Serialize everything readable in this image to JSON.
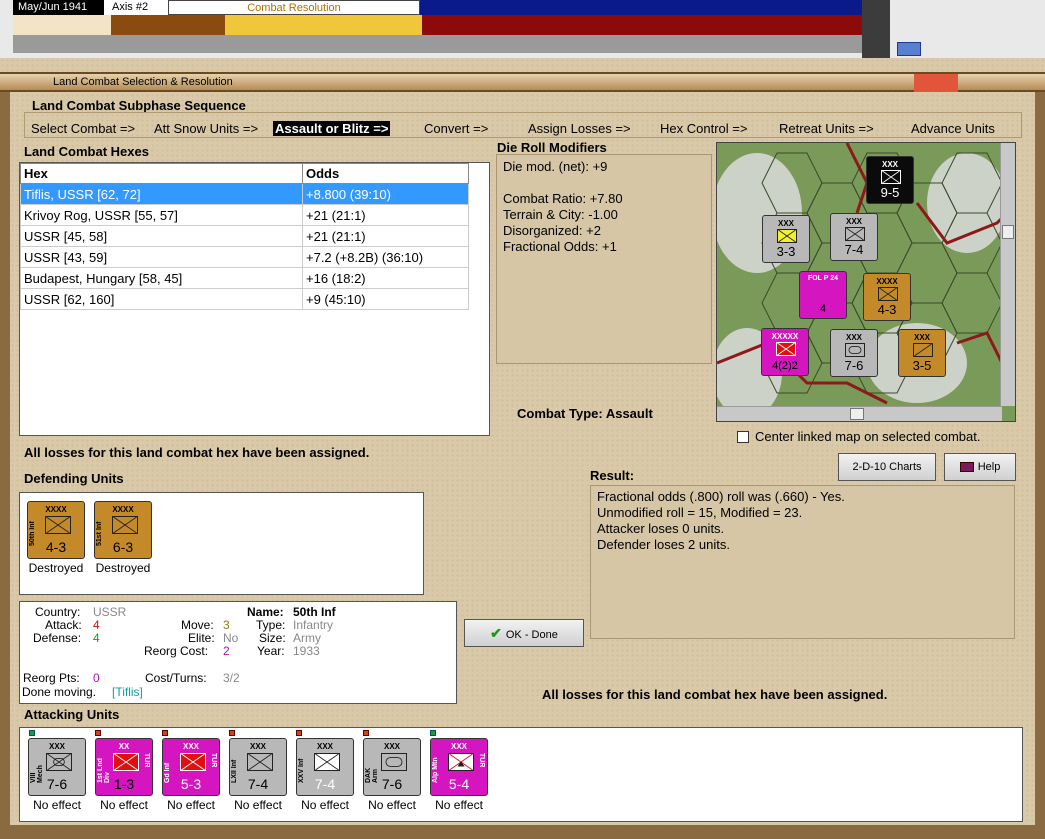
{
  "top": {
    "date": "May/Jun 1941",
    "axis": "Axis #2",
    "phase": "Combat Resolution"
  },
  "window": {
    "title": "Land Combat Selection & Resolution"
  },
  "sequence": {
    "header": "Land Combat Subphase Sequence",
    "steps": [
      "Select Combat =>",
      "Att Snow Units =>",
      "Assault or Blitz =>",
      "Convert =>",
      "Assign Losses =>",
      "Hex Control =>",
      "Retreat Units =>",
      "Advance Units"
    ],
    "active_index": 2
  },
  "hexes": {
    "header": "Land Combat Hexes",
    "columns": [
      "Hex",
      "Odds"
    ],
    "rows": [
      {
        "hex": "Tiflis, USSR [62, 72]",
        "odds": "+8.800 (39:10)"
      },
      {
        "hex": "Krivoy Rog, USSR [55, 57]",
        "odds": "+21 (21:1)"
      },
      {
        "hex": "USSR [45, 58]",
        "odds": "+21 (21:1)"
      },
      {
        "hex": "USSR [43, 59]",
        "odds": "+7.2 (+8.2B) (36:10)"
      },
      {
        "hex": "Budapest, Hungary [58, 45]",
        "odds": "+16 (18:2)"
      },
      {
        "hex": "USSR [62, 160]",
        "odds": "+9 (45:10)"
      }
    ]
  },
  "die_roll": {
    "header": "Die Roll Modifiers",
    "lines": [
      "Die mod. (net): +9",
      "",
      "Combat Ratio: +7.80",
      "Terrain & City: -1.00",
      "Disorganized: +2",
      "Fractional Odds: +1"
    ]
  },
  "combat_type": "Combat Type:  Assault",
  "center_map_label": "Center linked map on selected combat.",
  "losses_msg": "All losses for this land combat hex have been assigned.",
  "buttons": {
    "charts": "2-D-10 Charts",
    "help": "Help",
    "ok": "OK - Done"
  },
  "defending": {
    "header": "Defending Units",
    "units": [
      {
        "name": "50th Inf",
        "size": "XXXX",
        "str": "4-3",
        "status": "Destroyed"
      },
      {
        "name": "51st Inf",
        "size": "XXXX",
        "str": "6-3",
        "status": "Destroyed"
      }
    ]
  },
  "unit_info": {
    "country_label": "Country:",
    "country": "USSR",
    "attack_label": "Attack:",
    "attack": "4",
    "defense_label": "Defense:",
    "defense": "4",
    "move_label": "Move:",
    "move": "3",
    "elite_label": "Elite:",
    "elite": "No",
    "reorg_cost_label": "Reorg Cost:",
    "reorg_cost": "2",
    "name_label": "Name:",
    "name": "50th Inf",
    "type_label": "Type:",
    "type": "Infantry",
    "size_label": "Size:",
    "size": "Army",
    "year_label": "Year:",
    "year": "1933",
    "reorg_pts_label": "Reorg Pts:",
    "reorg_pts": "0",
    "cost_turns_label": "Cost/Turns:",
    "cost_turns": "3/2",
    "done_moving": "Done moving.",
    "done_moving_loc": "[Tiflis]"
  },
  "result": {
    "header": "Result:",
    "lines": [
      "Fractional odds (.800) roll was (.660)  - Yes.",
      "Unmodified roll = 15, Modified = 23.",
      "Attacker loses 0 units.",
      "Defender loses 2 units."
    ]
  },
  "attacking": {
    "header": "Attacking Units",
    "units": [
      {
        "name": "VIII Mech",
        "size": "XXX",
        "str": "7-6",
        "status": "No effect",
        "nation": ""
      },
      {
        "name": "1st Lnd Div",
        "size": "XX",
        "str": "1-3",
        "status": "No effect",
        "nation": "TUR"
      },
      {
        "name": "Gd Inf",
        "size": "XXX",
        "str": "5-3",
        "status": "No effect",
        "nation": "TUR"
      },
      {
        "name": "LXII Inf",
        "size": "XXX",
        "str": "7-4",
        "status": "No effect",
        "nation": ""
      },
      {
        "name": "XXV Inf",
        "size": "XXX",
        "str": "7-4",
        "status": "No effect",
        "nation": ""
      },
      {
        "name": "DAK Arm",
        "size": "XXX",
        "str": "7-6",
        "status": "No effect",
        "nation": ""
      },
      {
        "name": "Alp Mtn",
        "size": "XXX",
        "str": "5-4",
        "status": "No effect",
        "nation": "TUR"
      }
    ]
  },
  "map": {
    "counters": [
      {
        "name": "IX SS Mech",
        "str": "9-5",
        "size": "XXX"
      },
      {
        "name": "II Inf",
        "str": "3-3",
        "size": "XXX",
        "nation": "ROM"
      },
      {
        "name": "LXIII Inf",
        "str": "7-4",
        "size": "XXX"
      },
      {
        "name": "FOL P 24",
        "str": "4",
        "size": ""
      },
      {
        "name": "Tiflis Inf",
        "str": "4-3",
        "size": "XXXX"
      },
      {
        "name": "4(2)2",
        "str": "4(2)2",
        "size": "XXXXX",
        "nation": "TUR"
      },
      {
        "name": "DAK Arm",
        "str": "7-6",
        "size": "XXX"
      },
      {
        "name": "3rd Gd Cav",
        "str": "3-5",
        "size": "XXX"
      }
    ]
  },
  "colors": {
    "tan": "#d9c9a9",
    "selection": "#3399ff",
    "magenta": "#d415c0",
    "orange": "#c48a2a"
  }
}
